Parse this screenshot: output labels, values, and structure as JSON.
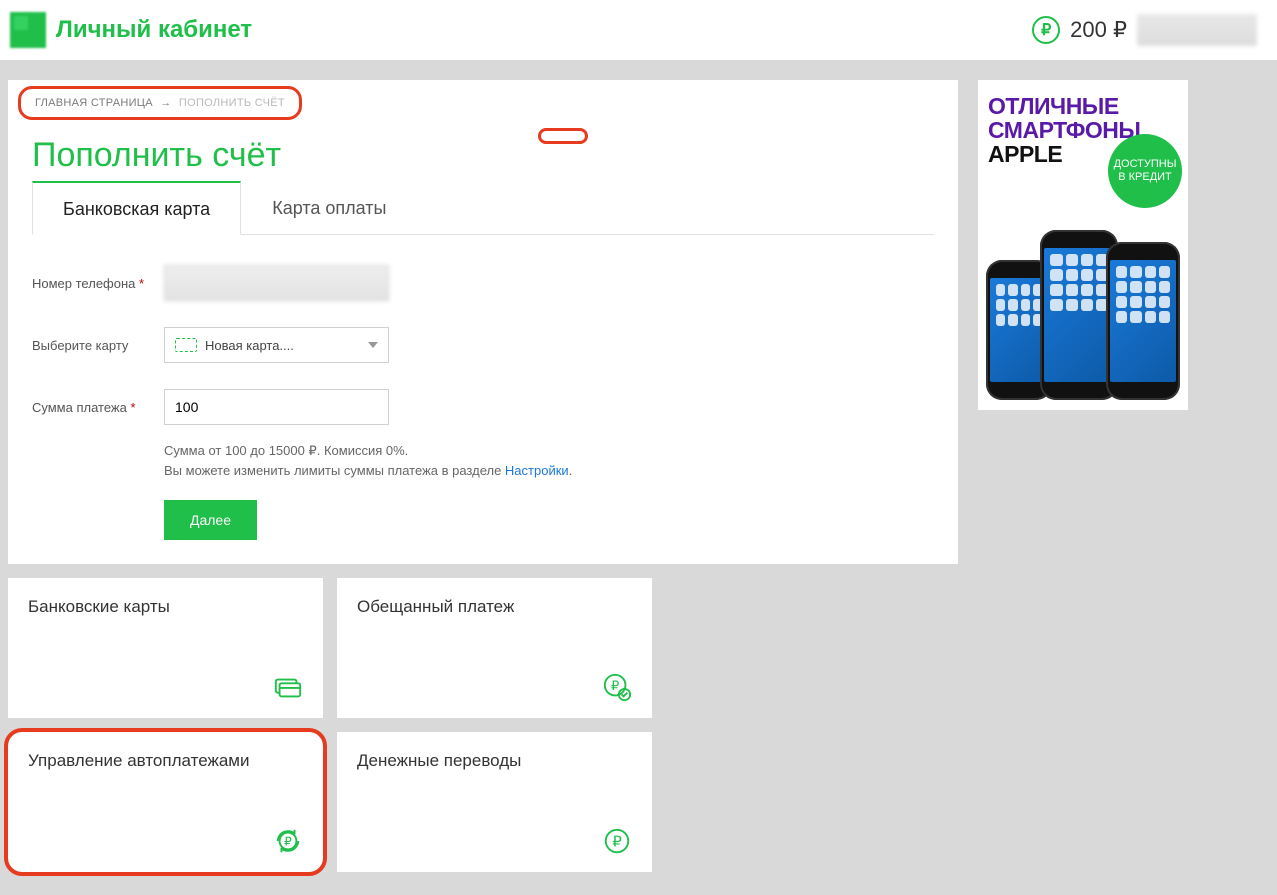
{
  "header": {
    "title": "Личный кабинет",
    "balance": "200 ₽",
    "ruble_symbol": "₽"
  },
  "breadcrumb": {
    "home": "ГЛАВНАЯ СТРАНИЦА",
    "arrow": "→",
    "current": "ПОПОЛНИТЬ СЧЁТ"
  },
  "page": {
    "heading": "Пополнить счёт"
  },
  "tabs": [
    {
      "label": "Банковская карта",
      "active": true
    },
    {
      "label": "Карта оплаты",
      "active": false
    }
  ],
  "form": {
    "phone_label": "Номер телефона",
    "card_label": "Выберите карту",
    "card_selected": "Новая карта....",
    "amount_label": "Сумма платежа",
    "amount_value": "100",
    "hint_line1": "Сумма от 100 до 15000 ₽. Комиссия 0%.",
    "hint_line2": "Вы можете изменить лимиты суммы платежа в разделе ",
    "hint_link": "Настройки",
    "submit": "Далее"
  },
  "tiles": [
    {
      "title": "Банковские карты",
      "icon": "card"
    },
    {
      "title": "Обещанный платеж",
      "icon": "ruble-check"
    },
    {
      "title": "Управление автоплатежами",
      "icon": "ruble-cycle",
      "highlight": true
    },
    {
      "title": "Денежные переводы",
      "icon": "ruble"
    }
  ],
  "ad": {
    "line1": "ОТЛИЧНЫЕ",
    "line2": "СМАРТФОНЫ",
    "line3": "APPLE",
    "badge": "ДОСТУПНЫ В КРЕДИТ"
  }
}
